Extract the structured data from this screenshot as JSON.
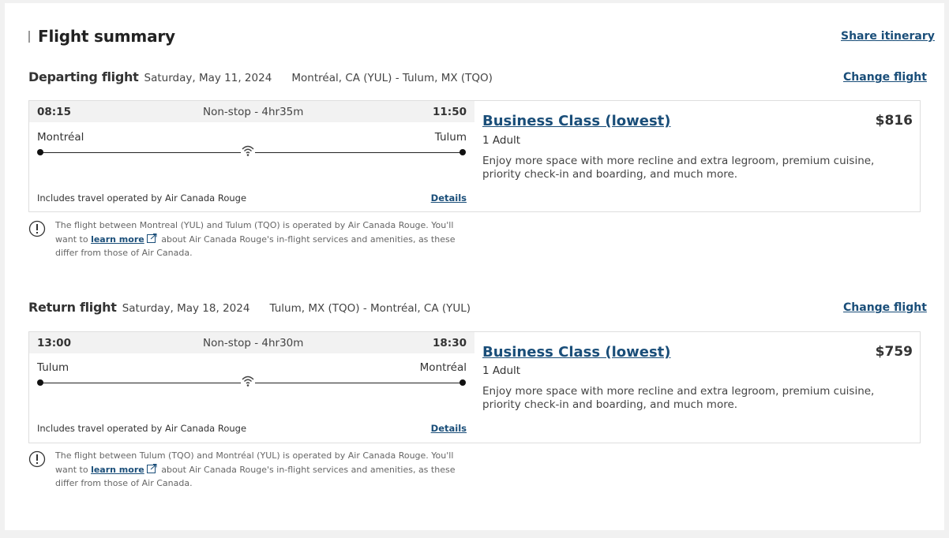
{
  "summary": {
    "title": "Flight summary",
    "share_label": "Share itinerary"
  },
  "departing": {
    "label": "Departing flight",
    "date": "Saturday, May 11, 2024",
    "route": "Montréal, CA (YUL) - Tulum, MX (TQO)",
    "change_label": "Change flight",
    "depart_time": "08:15",
    "duration": "Non-stop - 4hr35m",
    "arrive_time": "11:50",
    "origin_city": "Montréal",
    "dest_city": "Tulum",
    "operated_note": "Includes travel operated by Air Canada Rouge",
    "details_label": "Details",
    "fare_name": "Business Class (lowest)",
    "price": "$816",
    "passengers": "1 Adult",
    "fare_desc": "Enjoy more space with more recline and extra legroom, premium cuisine, priority check-in and boarding, and much more.",
    "notice_pre": "The flight between Montreal (YUL) and Tulum (TQO) is operated by Air Canada Rouge. You'll want to",
    "notice_link": "learn more",
    "notice_post": "about Air Canada Rouge's in-flight services and amenities, as these differ from those of Air Canada."
  },
  "return": {
    "label": "Return flight",
    "date": "Saturday, May 18, 2024",
    "route": "Tulum, MX (TQO) - Montréal, CA (YUL)",
    "change_label": "Change flight",
    "depart_time": "13:00",
    "duration": "Non-stop - 4hr30m",
    "arrive_time": "18:30",
    "origin_city": "Tulum",
    "dest_city": "Montréal",
    "operated_note": "Includes travel operated by Air Canada Rouge",
    "details_label": "Details",
    "fare_name": "Business Class (lowest)",
    "price": "$759",
    "passengers": "1 Adult",
    "fare_desc": "Enjoy more space with more recline and extra legroom, premium cuisine, priority check-in and boarding, and much more.",
    "notice_pre": "The flight between Tulum (TQO) and Montréal (YUL) is operated by Air Canada Rouge. You'll want to",
    "notice_link": "learn more",
    "notice_post": "about Air Canada Rouge's in-flight services and amenities, as these differ from those of Air Canada."
  },
  "icons": {
    "wifi": "wifi-icon",
    "notice": "exclamation-circle-icon",
    "external": "external-link-icon"
  },
  "colors": {
    "link": "#1a4e79",
    "times_bg": "#f2f2f2",
    "border": "#dedede"
  }
}
